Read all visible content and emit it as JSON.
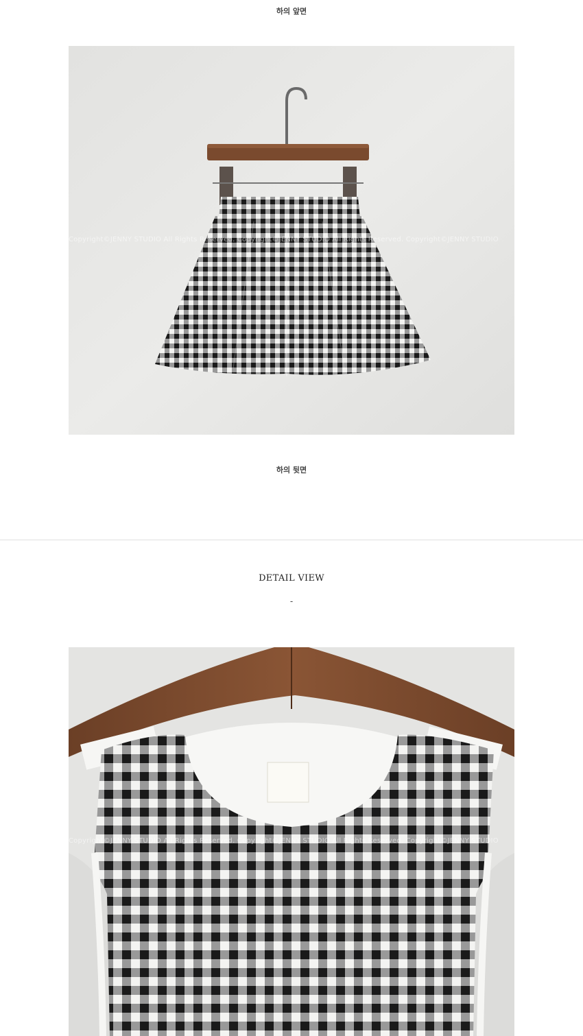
{
  "captions": {
    "front": "하의 앞면",
    "back": "하의 뒷면"
  },
  "photos": {
    "skirt": {
      "subject": "gingham skirt on wooden hanger",
      "watermark": "Copyright©JENNY STUDIO All Rights Reserved. Copyright©JENNY STUDIO All Rights Reserved. Copyright©JENNY STUDIO"
    },
    "top": {
      "subject": "gingham sleeveless top on wooden hanger",
      "watermark": "Copyright©JENNY STUDIO All Rights Reserved. Copyright©JENNY STUDIO All Rights Reserved. Copyright©JENNY STUDIO"
    }
  },
  "detail_section": {
    "title": "DETAIL VIEW",
    "separator": "-"
  },
  "colors": {
    "wall": "#e6e6e4",
    "wood": "#7a4a2e",
    "gingham_dark": "#1a1a1a",
    "gingham_light": "#f4f4f2"
  }
}
